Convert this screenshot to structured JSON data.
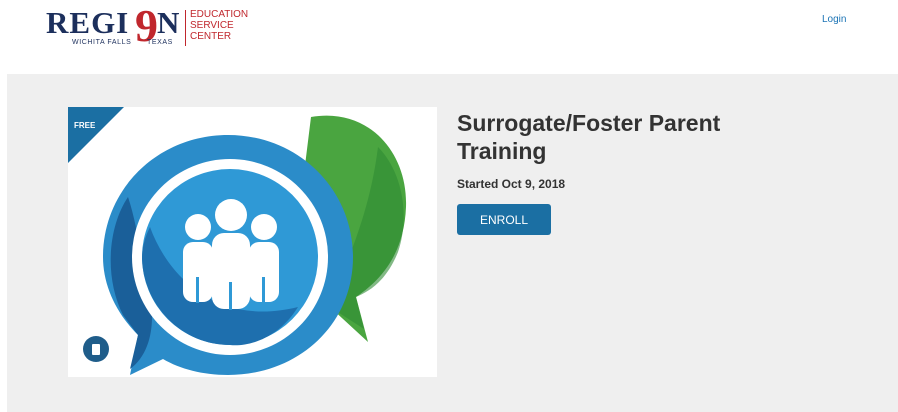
{
  "header": {
    "logo": {
      "word_left": "REGI",
      "numeral": "9",
      "word_right": "N",
      "city": "WICHITA FALLS",
      "state": "TEXAS",
      "esc_lines": [
        "EDUCATION",
        "SERVICE",
        "CENTER"
      ]
    },
    "login_label": "Login"
  },
  "course": {
    "badge": "FREE",
    "title": "Surrogate/Foster Parent Training",
    "started": "Started Oct 9, 2018",
    "enroll_label": "ENROLL",
    "image_icon": "people-speech-bubble-icon",
    "type_icon": "document-icon"
  },
  "colors": {
    "brand_navy": "#1c2f5c",
    "brand_red": "#c0272d",
    "primary_blue": "#1b6fa3",
    "hero_bg": "#efefef",
    "bubble_green": "#4aa540",
    "bubble_blue": "#2b8cc9"
  }
}
